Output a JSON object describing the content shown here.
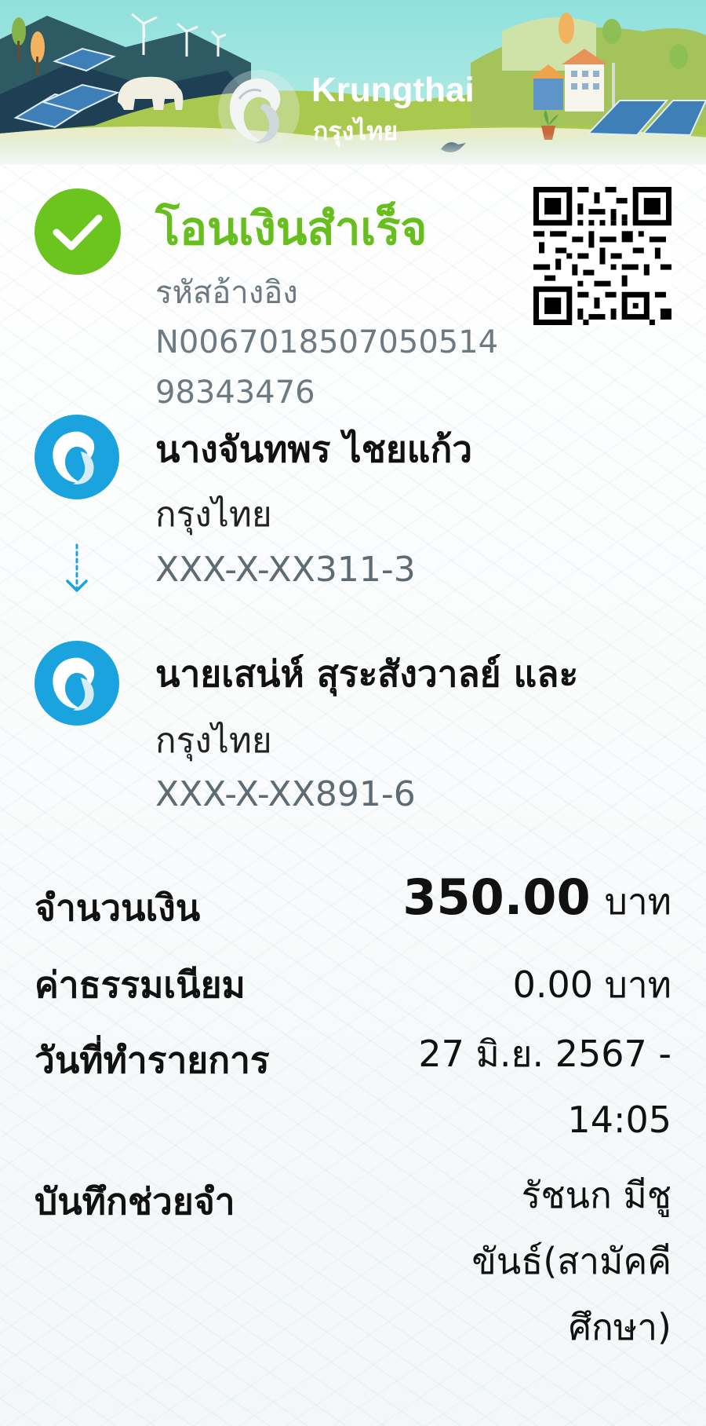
{
  "header": {
    "brand_en": "Krungthai",
    "brand_th": "กรุงไทย"
  },
  "status": {
    "title": "โอนเงินสำเร็จ",
    "ref_label": "รหัสอ้างอิง",
    "ref_value": "N006701850705051498343476",
    "icon": "check-circle-icon",
    "color": "#66bf1d"
  },
  "sender": {
    "name": "นางจันทพร ไชยแก้ว",
    "bank": "กรุงไทย",
    "account": "XXX-X-XX311-3"
  },
  "receiver": {
    "name": "นายเสน่ห์ สุระสังวาลย์ และ",
    "bank": "กรุงไทย",
    "account": "XXX-X-XX891-6"
  },
  "details": {
    "amount_label": "จำนวนเงิน",
    "amount_value": "350.00",
    "amount_unit": "บาท",
    "fee_label": "ค่าธรรมเนียม",
    "fee_value": "0.00 บาท",
    "date_label": "วันที่ทำรายการ",
    "date_value": "27 มิ.ย. 2567 - 14:05",
    "memo_label": "บันทึกช่วยจำ",
    "memo_value": "รัชนก มีชูขันธ์(สามัคคีศึกษา)"
  },
  "colors": {
    "bank_blue": "#1aa3df",
    "success_green": "#6cc51f"
  }
}
